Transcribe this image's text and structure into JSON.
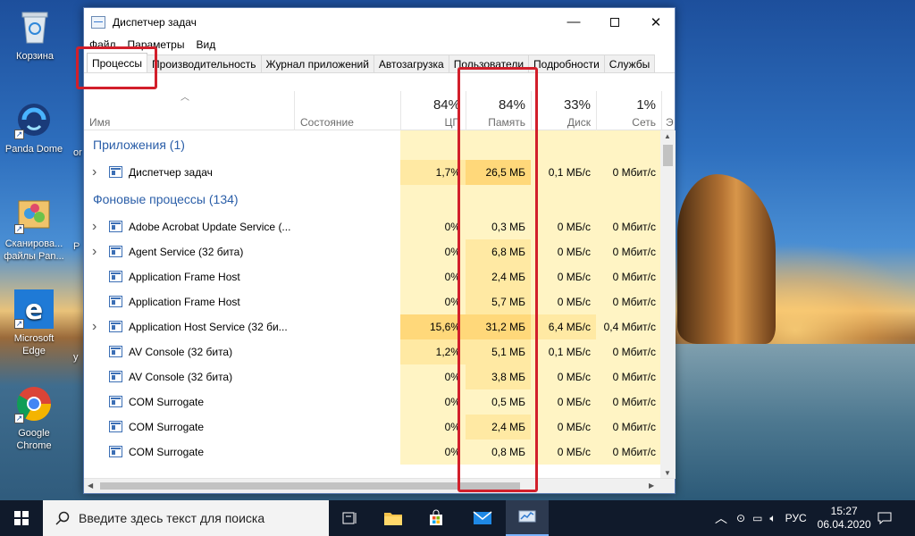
{
  "desktop": {
    "icons": [
      {
        "label": "Корзина"
      },
      {
        "label": "Panda Dome"
      },
      {
        "label": "Сканирова... файлы Pan..."
      },
      {
        "label": "Microsoft Edge"
      },
      {
        "label": "Google Chrome"
      }
    ],
    "clipped": [
      "or",
      "Р",
      "у"
    ]
  },
  "window": {
    "title": "Диспетчер задач",
    "menu": [
      "Файл",
      "Параметры",
      "Вид"
    ],
    "tabs": [
      "Процессы",
      "Производительность",
      "Журнал приложений",
      "Автозагрузка",
      "Пользователи",
      "Подробности",
      "Службы"
    ],
    "columns": {
      "name": "Имя",
      "status": "Состояние",
      "cpu": {
        "pct": "84%",
        "label": "ЦП"
      },
      "mem": {
        "pct": "84%",
        "label": "Память"
      },
      "disk": {
        "pct": "33%",
        "label": "Диск"
      },
      "net": {
        "pct": "1%",
        "label": "Сеть"
      },
      "extra": "Э"
    },
    "groups": {
      "apps": "Приложения (1)",
      "background": "Фоновые процессы (134)"
    },
    "app_rows": [
      {
        "name": "Диспетчер задач",
        "cpu": "1,7%",
        "mem": "26,5 МБ",
        "disk": "0,1 МБ/с",
        "net": "0 Мбит/с"
      }
    ],
    "bg_rows": [
      {
        "name": "Adobe Acrobat Update Service (...",
        "cpu": "0%",
        "mem": "0,3 МБ",
        "disk": "0 МБ/с",
        "net": "0 Мбит/с",
        "expand": true
      },
      {
        "name": "Agent Service (32 бита)",
        "cpu": "0%",
        "mem": "6,8 МБ",
        "disk": "0 МБ/с",
        "net": "0 Мбит/с",
        "expand": true
      },
      {
        "name": "Application Frame Host",
        "cpu": "0%",
        "mem": "2,4 МБ",
        "disk": "0 МБ/с",
        "net": "0 Мбит/с",
        "expand": false
      },
      {
        "name": "Application Frame Host",
        "cpu": "0%",
        "mem": "5,7 МБ",
        "disk": "0 МБ/с",
        "net": "0 Мбит/с",
        "expand": false
      },
      {
        "name": "Application Host Service (32 би...",
        "cpu": "15,6%",
        "mem": "31,2 МБ",
        "disk": "6,4 МБ/с",
        "net": "0,4 Мбит/с",
        "expand": true
      },
      {
        "name": "AV Console (32 бита)",
        "cpu": "1,2%",
        "mem": "5,1 МБ",
        "disk": "0,1 МБ/с",
        "net": "0 Мбит/с",
        "expand": false
      },
      {
        "name": "AV Console (32 бита)",
        "cpu": "0%",
        "mem": "3,8 МБ",
        "disk": "0 МБ/с",
        "net": "0 Мбит/с",
        "expand": false
      },
      {
        "name": "COM Surrogate",
        "cpu": "0%",
        "mem": "0,5 МБ",
        "disk": "0 МБ/с",
        "net": "0 Мбит/с",
        "expand": false
      },
      {
        "name": "COM Surrogate",
        "cpu": "0%",
        "mem": "2,4 МБ",
        "disk": "0 МБ/с",
        "net": "0 Мбит/с",
        "expand": false
      },
      {
        "name": "COM Surrogate",
        "cpu": "0%",
        "mem": "0,8 МБ",
        "disk": "0 МБ/с",
        "net": "0 Мбит/с",
        "expand": false
      }
    ]
  },
  "taskbar": {
    "search_placeholder": "Введите здесь текст для поиска",
    "lang": "РУС",
    "time": "15:27",
    "date": "06.04.2020"
  },
  "colors": {
    "highlight": "#d21f2b",
    "heat_low": "#fff4c4",
    "heat_mid": "#ffe9a3",
    "heat_high": "#ffd87a",
    "group_text": "#2a5ea8"
  }
}
